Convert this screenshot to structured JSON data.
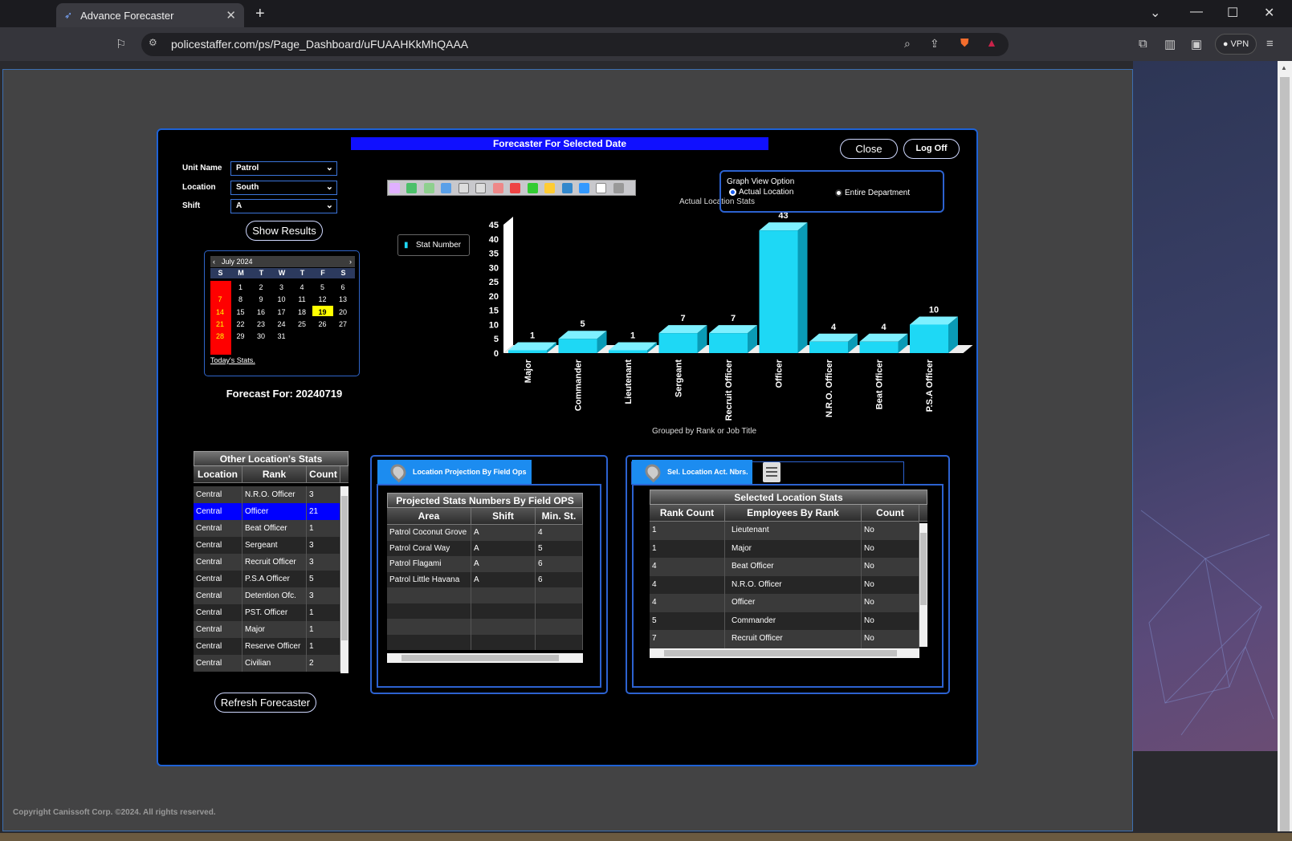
{
  "browser": {
    "tab_title": "Advance Forecaster",
    "url": "policestaffer.com/ps/Page_Dashboard/uFUAAHKkMhQAAA",
    "vpn_label": "VPN"
  },
  "panel": {
    "title": "Forecaster For Selected Date",
    "close_label": "Close",
    "logoff_label": "Log Off"
  },
  "filters": {
    "unit_label": "Unit Name",
    "unit_value": "Patrol",
    "location_label": "Location",
    "location_value": "South",
    "shift_label": "Shift",
    "shift_value": "A",
    "show_results_label": "Show Results"
  },
  "calendar": {
    "month": "July 2024",
    "weekdays": [
      "S",
      "M",
      "T",
      "W",
      "T",
      "F",
      "S"
    ],
    "weeks": [
      [
        "",
        "1",
        "2",
        "3",
        "4",
        "5",
        "6"
      ],
      [
        "7",
        "8",
        "9",
        "10",
        "11",
        "12",
        "13"
      ],
      [
        "14",
        "15",
        "16",
        "17",
        "18",
        "19",
        "20"
      ],
      [
        "21",
        "22",
        "23",
        "24",
        "25",
        "26",
        "27"
      ],
      [
        "28",
        "29",
        "30",
        "31",
        "",
        "",
        ""
      ]
    ],
    "selected_day": "19",
    "todays_stats_label": "Today's Stats."
  },
  "forecast_for": "Forecast For: 20240719",
  "graph_view": {
    "title": "Graph View Option",
    "option_actual": "Actual Location",
    "option_department": "Entire Department",
    "selected": "Actual Location"
  },
  "chart_legend_label": "Stat Number",
  "chart_data": {
    "type": "bar",
    "title": "Actual Location Stats",
    "xlabel": "Grouped by Rank or Job Title",
    "ylabel": "",
    "categories": [
      "Major",
      "Commander",
      "Lieutenant",
      "Sergeant",
      "Recruit Officer",
      "Officer",
      "N.R.O. Officer",
      "Beat Officer",
      "P.S.A Officer"
    ],
    "series": [
      {
        "name": "Stat Number",
        "values": [
          1,
          5,
          1,
          7,
          7,
          43,
          4,
          4,
          10
        ]
      }
    ],
    "ylim": [
      0,
      45
    ],
    "yticks": [
      0,
      5,
      10,
      15,
      20,
      25,
      30,
      35,
      40,
      45
    ],
    "bar_color": "#1ed8f5"
  },
  "other_locations": {
    "title": "Other Location's Stats",
    "columns": [
      "Location",
      "Rank",
      "Count"
    ],
    "rows": [
      [
        "Central",
        "N.R.O. Officer",
        "3"
      ],
      [
        "Central",
        "Officer",
        "21"
      ],
      [
        "Central",
        "Beat Officer",
        "1"
      ],
      [
        "Central",
        "Sergeant",
        "3"
      ],
      [
        "Central",
        "Recruit Officer",
        "3"
      ],
      [
        "Central",
        "P.S.A Officer",
        "5"
      ],
      [
        "Central",
        "Detention Ofc.",
        "3"
      ],
      [
        "Central",
        "PST. Officer",
        "1"
      ],
      [
        "Central",
        "Major",
        "1"
      ],
      [
        "Central",
        "Reserve Officer",
        "1"
      ],
      [
        "Central",
        "Civilian",
        "2"
      ]
    ],
    "selected_row": 1
  },
  "refresh_label": "Refresh Forecaster",
  "projection": {
    "tab_label": "Location Projection By Field Ops",
    "title": "Projected Stats Numbers By Field OPS",
    "columns": [
      "Area",
      "Shift",
      "Min. St."
    ],
    "rows": [
      [
        "Patrol Coconut Grove",
        "A",
        "4"
      ],
      [
        "Patrol Coral Way",
        "A",
        "5"
      ],
      [
        "Patrol Flagami",
        "A",
        "6"
      ],
      [
        "Patrol Little Havana",
        "A",
        "6"
      ],
      [
        "",
        "",
        ""
      ],
      [
        "",
        "",
        ""
      ],
      [
        "",
        "",
        ""
      ],
      [
        "",
        "",
        ""
      ]
    ]
  },
  "selected_location": {
    "tab_label": "Sel. Location Act. Nbrs.",
    "title": "Selected Location Stats",
    "columns": [
      "Rank Count",
      "Employees By Rank",
      "Count"
    ],
    "rows": [
      [
        "1",
        "Lieutenant",
        "No"
      ],
      [
        "1",
        "Major",
        "No"
      ],
      [
        "4",
        "Beat Officer",
        "No"
      ],
      [
        "4",
        "N.R.O. Officer",
        "No"
      ],
      [
        "4",
        "Officer",
        "No"
      ],
      [
        "5",
        "Commander",
        "No"
      ],
      [
        "7",
        "Recruit Officer",
        "No"
      ]
    ]
  },
  "copyright": "Copyright Canissoft Corp. ©2024. All rights reserved."
}
